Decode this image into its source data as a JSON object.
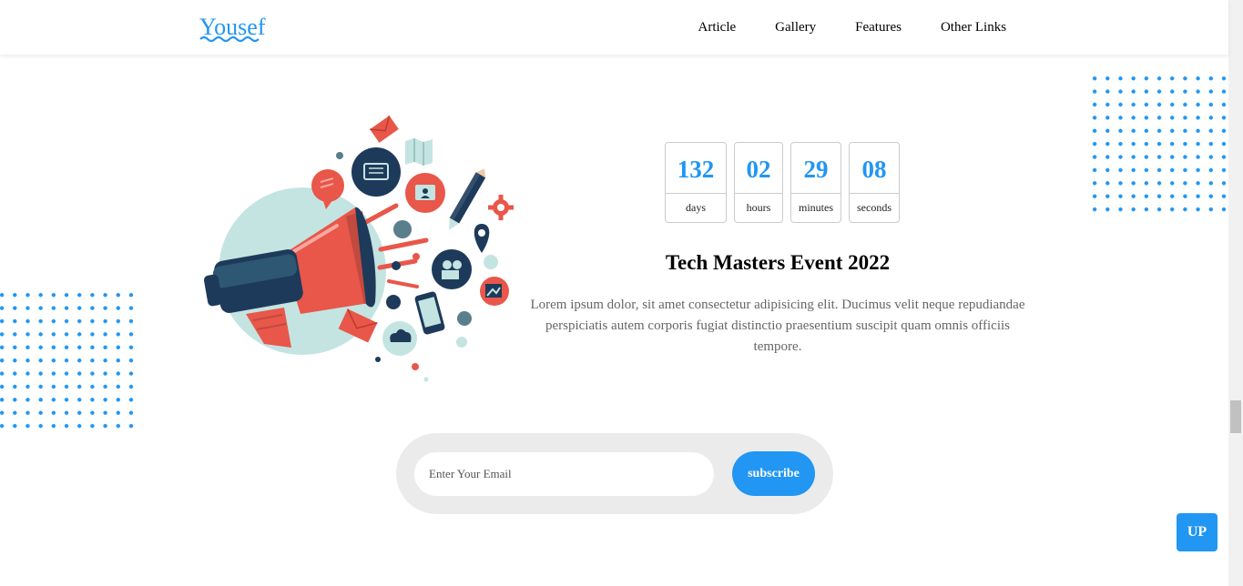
{
  "header": {
    "logo": "Yousef",
    "nav": [
      "Article",
      "Gallery",
      "Features",
      "Other Links"
    ]
  },
  "countdown": [
    {
      "value": "132",
      "label": "days"
    },
    {
      "value": "02",
      "label": "hours"
    },
    {
      "value": "29",
      "label": "minutes"
    },
    {
      "value": "08",
      "label": "seconds"
    }
  ],
  "event": {
    "title": "Tech Masters Event 2022",
    "text": "Lorem ipsum dolor, sit amet consectetur adipisicing elit. Ducimus velit neque repudiandae perspiciatis autem corporis fugiat distinctio praesentium suscipit quam omnis officiis tempore."
  },
  "subscribe": {
    "placeholder": "Enter Your Email",
    "button": "subscribe"
  },
  "up_button": "UP",
  "colors": {
    "accent": "#2196f3",
    "megaphone_red": "#e8574a",
    "navy": "#1e3a5a",
    "mint": "#c4e4e2"
  }
}
